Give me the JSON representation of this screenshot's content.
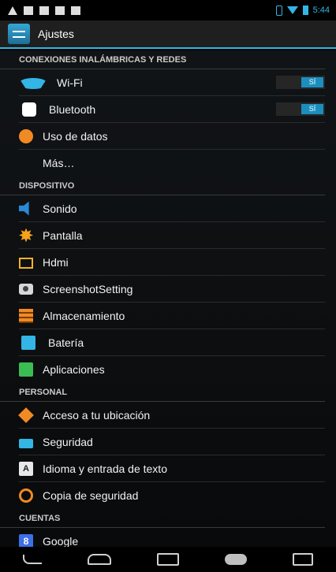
{
  "status": {
    "time": "5:44"
  },
  "actionbar": {
    "title": "Ajustes"
  },
  "sections": [
    {
      "header": "CONEXIONES INALÁMBRICAS Y REDES",
      "items": [
        {
          "label": "Wi-Fi",
          "icon": "wifi-icon",
          "toggle": "SÍ"
        },
        {
          "label": "Bluetooth",
          "icon": "bluetooth-icon",
          "toggle": "SÍ"
        },
        {
          "label": "Uso de datos",
          "icon": "data-usage-icon"
        },
        {
          "label": "Más…"
        }
      ]
    },
    {
      "header": "DISPOSITIVO",
      "items": [
        {
          "label": "Sonido",
          "icon": "volume-icon"
        },
        {
          "label": "Pantalla",
          "icon": "brightness-icon"
        },
        {
          "label": "Hdmi",
          "icon": "monitor-icon"
        },
        {
          "label": "ScreenshotSetting",
          "icon": "camera-icon"
        },
        {
          "label": "Almacenamiento",
          "icon": "storage-icon"
        },
        {
          "label": "Batería",
          "icon": "battery-icon"
        },
        {
          "label": "Aplicaciones",
          "icon": "apps-icon"
        }
      ]
    },
    {
      "header": "PERSONAL",
      "items": [
        {
          "label": "Acceso a tu ubicación",
          "icon": "location-icon"
        },
        {
          "label": "Seguridad",
          "icon": "lock-icon"
        },
        {
          "label": "Idioma y entrada de texto",
          "icon": "language-icon",
          "icon_glyph": "A"
        },
        {
          "label": "Copia de seguridad",
          "icon": "backup-icon"
        }
      ]
    },
    {
      "header": "CUENTAS",
      "items": [
        {
          "label": "Google",
          "icon": "google-icon",
          "icon_glyph": "8"
        }
      ]
    }
  ]
}
